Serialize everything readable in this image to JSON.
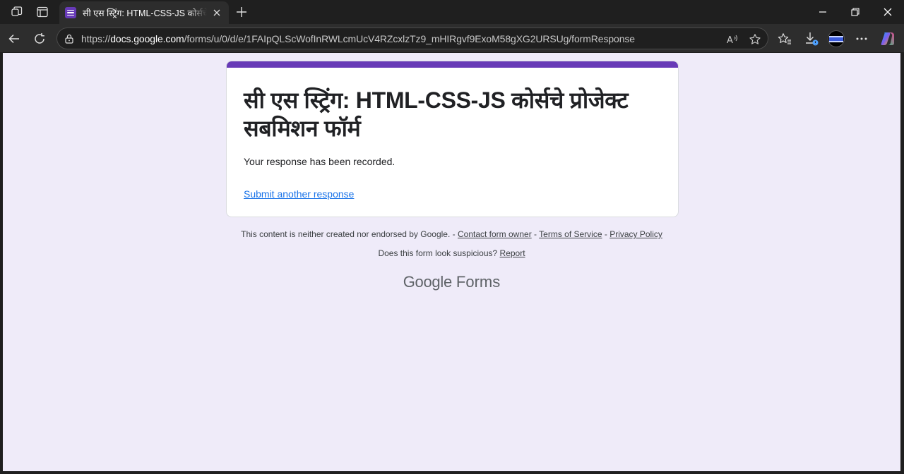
{
  "browser": {
    "tab": {
      "title": "सी एस स्ट्रिंग: HTML-CSS-JS कोर्सचे प्रोजेक्ट सबमिशन फॉर्म"
    },
    "url": {
      "scheme": "https://",
      "host": "docs.google.com",
      "path": "/forms/u/0/d/e/1FAIpQLScWofInRWLcmUcV4RZcxlzTz9_mHIRgvf9ExoM58gXG2URSUg/formResponse"
    },
    "icons": [
      "workspaces-icon",
      "tab-actions-icon",
      "close-tab-icon",
      "new-tab-icon",
      "minimize-icon",
      "restore-icon",
      "close-window-icon",
      "back-icon",
      "refresh-icon",
      "lock-icon",
      "read-aloud-icon",
      "favorite-star-icon",
      "favorites-icon",
      "downloads-icon",
      "profile-avatar",
      "more-icon",
      "copilot-icon"
    ]
  },
  "form": {
    "title": "सी एस स्ट्रिंग: HTML-CSS-JS कोर्सचे प्रोजेक्ट सबमिशन फॉर्म",
    "confirmation": "Your response has been recorded.",
    "submit_another": "Submit another response",
    "accent_color": "#673ab7"
  },
  "footer": {
    "disclaimer": "This content is neither created nor endorsed by Google.",
    "sep1": " - ",
    "contact": "Contact form owner",
    "sep2": " - ",
    "terms": "Terms of Service",
    "sep3": " - ",
    "privacy": "Privacy Policy",
    "suspicious": "Does this form look suspicious?",
    "report": "Report",
    "brand_google": "Google",
    "brand_forms": "Forms"
  }
}
